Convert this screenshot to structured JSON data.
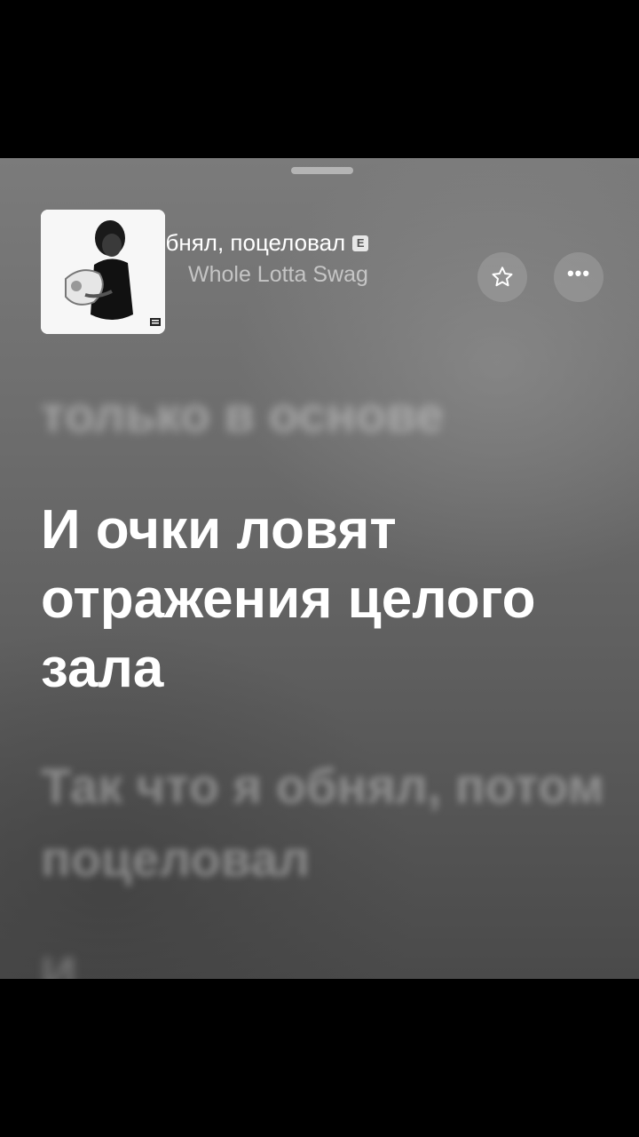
{
  "player": {
    "track_title": "обнял, поцеловал",
    "explicit_badge": "E",
    "artist": "Whole Lotta Swag",
    "favorite_icon": "star-icon",
    "more_icon": "ellipsis-icon",
    "more_label": "•••"
  },
  "lyrics": {
    "previous": "только в основе",
    "current": "И очки ловят отражения целого зала",
    "next": "Так что я обнял, потом поцеловал",
    "following": "И"
  },
  "colors": {
    "background_top": "#7b7b7b",
    "background_bottom": "#4a4a4a",
    "active_lyric": "#ffffff"
  }
}
